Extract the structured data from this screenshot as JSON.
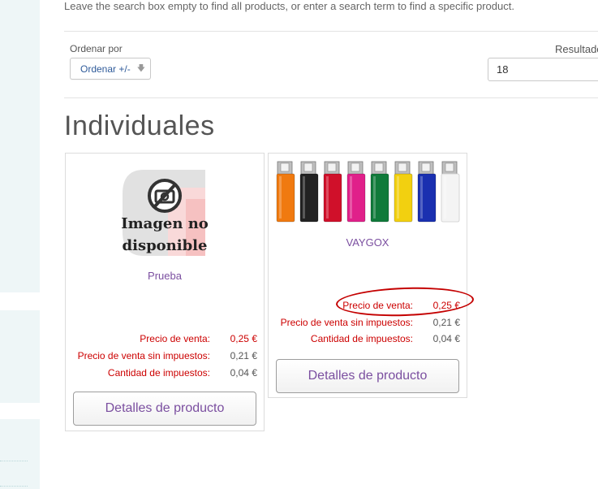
{
  "intro": "Leave the search box empty to find all products, or enter a search term to find a specific product.",
  "sort": {
    "label": "Ordenar por",
    "button_label": "Ordenar +/-"
  },
  "results": {
    "label": "Resultados",
    "value": "18"
  },
  "category_title": "Individuales",
  "products": [
    {
      "name": "Prueba",
      "image_text_line1": "Imagen no",
      "image_text_line2": "disponible",
      "price_label": "Precio de venta:",
      "price_value": "0,25 €",
      "price_no_tax_label": "Precio de venta sin impuestos:",
      "price_no_tax_value": "0,21 €",
      "tax_label": "Cantidad de impuestos:",
      "tax_value": "0,04 €",
      "details_button": "Detalles de producto"
    },
    {
      "name": "VAYGOX",
      "price_label": "Precio de venta:",
      "price_value": "0,25 €",
      "price_no_tax_label": "Precio de venta sin impuestos:",
      "price_no_tax_value": "0,21 €",
      "tax_label": "Cantidad de impuestos:",
      "tax_value": "0,04 €",
      "details_button": "Detalles de producto",
      "lighter_colors": [
        "#f07a10",
        "#222222",
        "#d0102a",
        "#e0208a",
        "#107a3a",
        "#f2d010",
        "#1a30b0",
        "#f4f4f4"
      ]
    }
  ],
  "colors": {
    "price_red": "#cc0000",
    "link_purple": "#7b4fa0",
    "annotation_red": "#c40000"
  }
}
